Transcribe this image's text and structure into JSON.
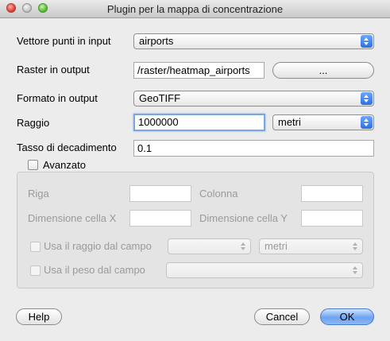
{
  "window": {
    "title": "Plugin per la mappa di concentrazione"
  },
  "input_vector": {
    "label": "Vettore punti in input",
    "value": "airports"
  },
  "output_raster": {
    "label": "Raster in output",
    "value": "/raster/heatmap_airports",
    "browse_label": "..."
  },
  "output_format": {
    "label": "Formato in output",
    "value": "GeoTIFF"
  },
  "radius": {
    "label": "Raggio",
    "value": "1000000",
    "unit": "metri"
  },
  "decay": {
    "label": "Tasso di decadimento",
    "value": "0.1"
  },
  "advanced": {
    "label": "Avanzato",
    "checked": false,
    "row_label": "Riga",
    "row_value": "",
    "column_label": "Colonna",
    "column_value": "",
    "cell_x_label": "Dimensione cella X",
    "cell_x_value": "",
    "cell_y_label": "Dimensione cella Y",
    "cell_y_value": "",
    "radius_field_label": "Usa il raggio dal campo",
    "radius_field_value": "",
    "radius_field_unit": "metri",
    "weight_field_label": "Usa il peso dal campo",
    "weight_field_value": ""
  },
  "buttons": {
    "help": "Help",
    "cancel": "Cancel",
    "ok": "OK"
  }
}
